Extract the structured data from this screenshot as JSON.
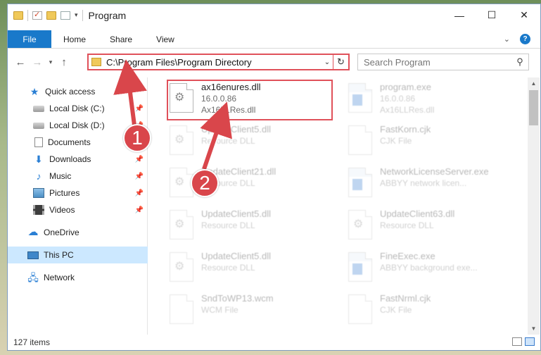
{
  "window": {
    "title": "Program",
    "controls": [
      "—",
      "☐",
      "✕"
    ]
  },
  "ribbon": {
    "tabs": [
      "File",
      "Home",
      "Share",
      "View"
    ]
  },
  "nav": {
    "back": "←",
    "forward": "→",
    "up": "↑",
    "address": "C:\\Program Files\\Program Directory",
    "search_placeholder": "Search Program"
  },
  "sidebar": {
    "items": [
      {
        "label": "Quick access",
        "icon": "star-icon"
      },
      {
        "label": "Local Disk (C:)",
        "icon": "disk-icon",
        "pinned": true
      },
      {
        "label": "Local Disk (D:)",
        "icon": "disk-icon",
        "pinned": true
      },
      {
        "label": "Documents",
        "icon": "document-icon",
        "pinned": true
      },
      {
        "label": "Downloads",
        "icon": "download-icon",
        "pinned": true
      },
      {
        "label": "Music",
        "icon": "music-icon",
        "pinned": true
      },
      {
        "label": "Pictures",
        "icon": "pictures-icon",
        "pinned": true
      },
      {
        "label": "Videos",
        "icon": "videos-icon",
        "pinned": true
      },
      {
        "label": "OneDrive",
        "icon": "cloud-icon"
      },
      {
        "label": "This PC",
        "icon": "computer-icon",
        "selected": true
      },
      {
        "label": "Network",
        "icon": "network-icon"
      }
    ]
  },
  "files": {
    "featured": {
      "name": "ax16enures.dll",
      "version": "16.0.0.86",
      "desc": "Ax16LLRes.dll"
    },
    "items": [
      {
        "name": "program.exe",
        "line2": "16.0.0.86",
        "line3": "Ax16LLRes.dll",
        "kind": "exe"
      },
      {
        "name": "UpdateClient5.dll",
        "line2": "Resource DLL",
        "kind": "dll"
      },
      {
        "name": "FastKorn.cjk",
        "line2": "CJK File",
        "kind": "file"
      },
      {
        "name": "UpdateClient21.dll",
        "line2": "Resource DLL",
        "kind": "dll"
      },
      {
        "name": "NetworkLicenseServer.exe",
        "line2": "ABBYY network licen...",
        "kind": "exe"
      },
      {
        "name": "UpdateClient5.dll",
        "line2": "Resource DLL",
        "kind": "dll"
      },
      {
        "name": "UpdateClient63.dll",
        "line2": "Resource DLL",
        "kind": "dll"
      },
      {
        "name": "UpdateClient5.dll",
        "line2": "Resource DLL",
        "kind": "dll"
      },
      {
        "name": "FineExec.exe",
        "line2": "ABBYY background exe...",
        "kind": "exe"
      },
      {
        "name": "SndToWP13.wcm",
        "line2": "WCM File",
        "kind": "file"
      },
      {
        "name": "FastNrml.cjk",
        "line2": "CJK File",
        "kind": "file"
      }
    ]
  },
  "status": {
    "count": "127 items"
  },
  "callouts": [
    "1",
    "2"
  ],
  "colors": {
    "accent": "#1979ca",
    "highlight": "#e0515a",
    "callout": "#d9464b"
  }
}
